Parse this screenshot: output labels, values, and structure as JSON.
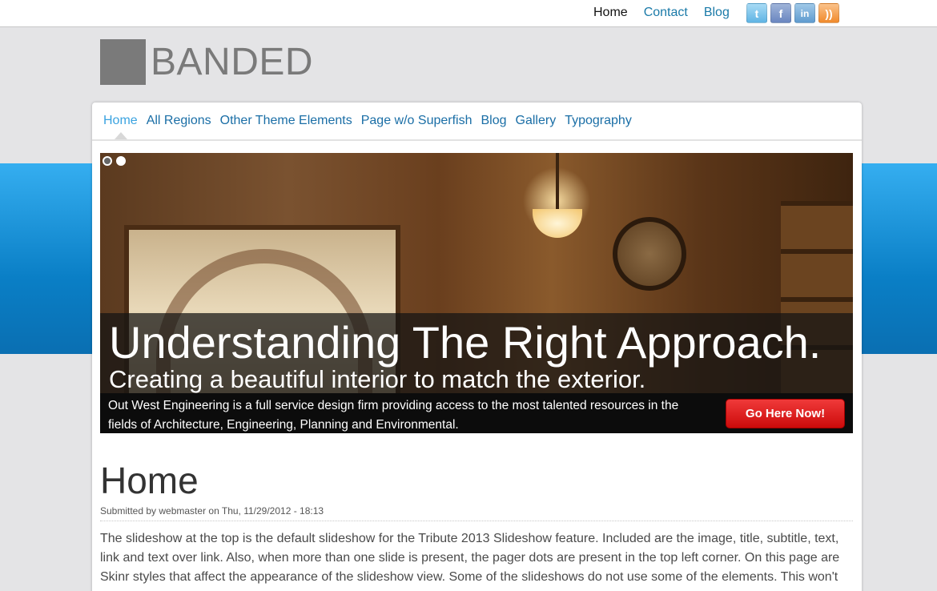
{
  "top_nav": {
    "links": [
      {
        "label": "Home",
        "active": true
      },
      {
        "label": "Contact"
      },
      {
        "label": "Blog"
      }
    ],
    "social": [
      {
        "name": "twitter-icon",
        "glyph": "t"
      },
      {
        "name": "facebook-icon",
        "glyph": "f"
      },
      {
        "name": "linkedin-icon",
        "glyph": "in"
      },
      {
        "name": "rss-icon",
        "glyph": "))"
      }
    ]
  },
  "header": {
    "site_name": "BANDED"
  },
  "main_nav": {
    "items": [
      {
        "label": "Home",
        "active": true
      },
      {
        "label": "All Regions"
      },
      {
        "label": "Other Theme Elements"
      },
      {
        "label": "Page w/o Superfish"
      },
      {
        "label": "Blog"
      },
      {
        "label": "Gallery"
      },
      {
        "label": "Typography"
      }
    ]
  },
  "slideshow": {
    "title": "Understanding The Right Approach.",
    "subtitle": "Creating a beautiful interior to match the exterior.",
    "text": "Out West Engineering is a full service design firm providing access to the most talented resources in the fields of Architecture, Engineering, Planning and Environmental.",
    "button_label": "Go Here Now!",
    "pager_count": 2,
    "pager_active": 2
  },
  "content": {
    "title": "Home",
    "meta": "Submitted by webmaster on Thu, 11/29/2012 - 18:13",
    "body": "The slideshow at the top is the default slideshow for the Tribute 2013 Slideshow feature. Included are the image, title, subtitle, text, link and text over link. Also, when more than one slide is present, the pager dots are present in the top left corner. On this page are Skinr styles that affect the appearance of the slideshow view. Some of the slideshows do not use some of the elements. This won't"
  },
  "colors": {
    "band": "#0a7fc6",
    "link": "#1a6ea6",
    "active_link": "#3aa3e0",
    "button": "#e01f1f"
  }
}
